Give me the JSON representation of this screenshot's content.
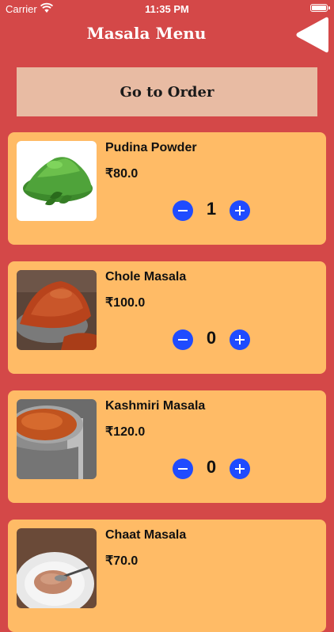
{
  "status_bar": {
    "carrier": "Carrier",
    "time": "11:35 PM"
  },
  "header": {
    "title": "Masala Menu",
    "back_icon": "triangle-left-icon"
  },
  "order_button": {
    "label": "Go to Order"
  },
  "products": [
    {
      "name": "Pudina Powder",
      "price": "₹80.0",
      "quantity": "1"
    },
    {
      "name": "Chole Masala",
      "price": "₹100.0",
      "quantity": "0"
    },
    {
      "name": "Kashmiri Masala",
      "price": "₹120.0",
      "quantity": "0"
    },
    {
      "name": "Chaat Masala",
      "price": "₹70.0",
      "quantity": ""
    }
  ],
  "colors": {
    "background": "#d44848",
    "card": "#ffbb66",
    "order_button": "#e8bba3",
    "qty_button": "#1f4bff"
  }
}
